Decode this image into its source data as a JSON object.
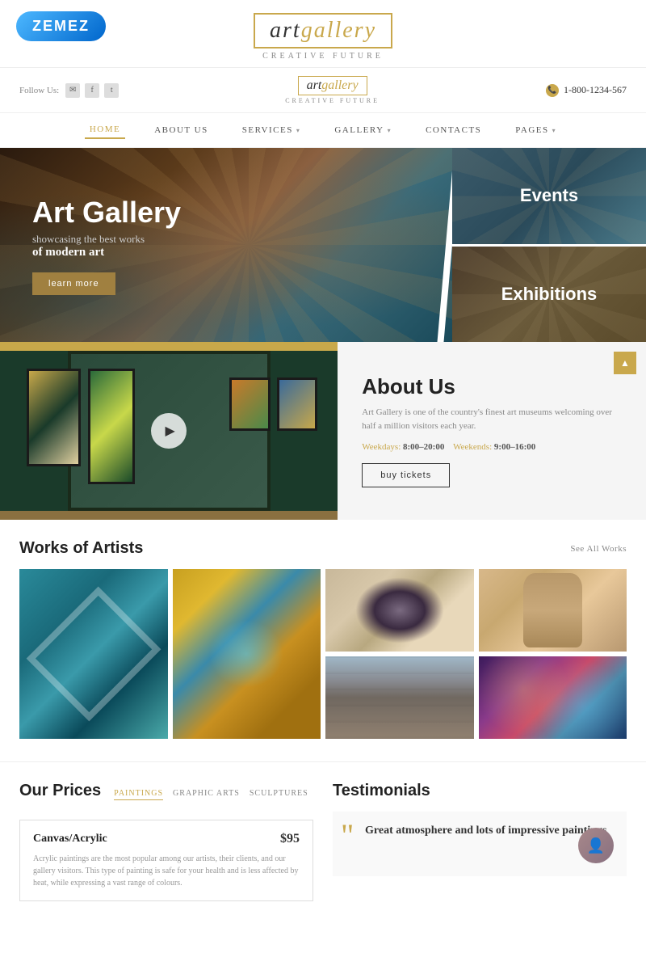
{
  "brand": {
    "zemez": "ZEMEZ",
    "logo_art": "art",
    "logo_gallery": "gallery",
    "tagline": "CREATIVE FUTURE"
  },
  "header": {
    "follow_label": "Follow Us:",
    "socials": [
      "✉",
      "f",
      "t"
    ],
    "phone": "1-800-1234-567"
  },
  "nav": {
    "items": [
      {
        "label": "HOME",
        "active": true,
        "has_arrow": false
      },
      {
        "label": "ABOUT US",
        "active": false,
        "has_arrow": false
      },
      {
        "label": "SERVICES",
        "active": false,
        "has_arrow": true
      },
      {
        "label": "GALLERY",
        "active": false,
        "has_arrow": true
      },
      {
        "label": "CONTACTS",
        "active": false,
        "has_arrow": false
      },
      {
        "label": "PAGES",
        "active": false,
        "has_arrow": true
      }
    ]
  },
  "hero": {
    "title": "Art Gallery",
    "subtitle": "showcasing the best works",
    "subtitle_bold": "of modern art",
    "cta_label": "learn more",
    "events_label": "Events",
    "exhibitions_label": "Exhibitions"
  },
  "about": {
    "title": "About Us",
    "description": "Art Gallery is one of the country's finest art museums welcoming over half a million visitors each year.",
    "weekdays_label": "Weekdays:",
    "weekdays_value": "8:00–20:00",
    "weekends_label": "Weekends:",
    "weekends_value": "9:00–16:00",
    "cta_label": "buy tickets"
  },
  "works": {
    "section_title": "Works of Artists",
    "see_all_label": "See All Works"
  },
  "prices": {
    "section_title": "Our Prices",
    "tabs": [
      "PAINTINGS",
      "GRAPHIC ARTS",
      "SCULPTURES"
    ],
    "active_tab": 0,
    "card": {
      "name": "Canvas/Acrylic",
      "amount": "$95",
      "description": "Acrylic paintings are the most popular among our artists, their clients, and our gallery visitors. This type of painting is safe for your health and is less affected by heat, while expressing a vast range of colours."
    }
  },
  "testimonials": {
    "section_title": "Testimonials",
    "quote": "Great atmosphere and lots of impressive paintings",
    "subtext": "atmosphere and"
  }
}
